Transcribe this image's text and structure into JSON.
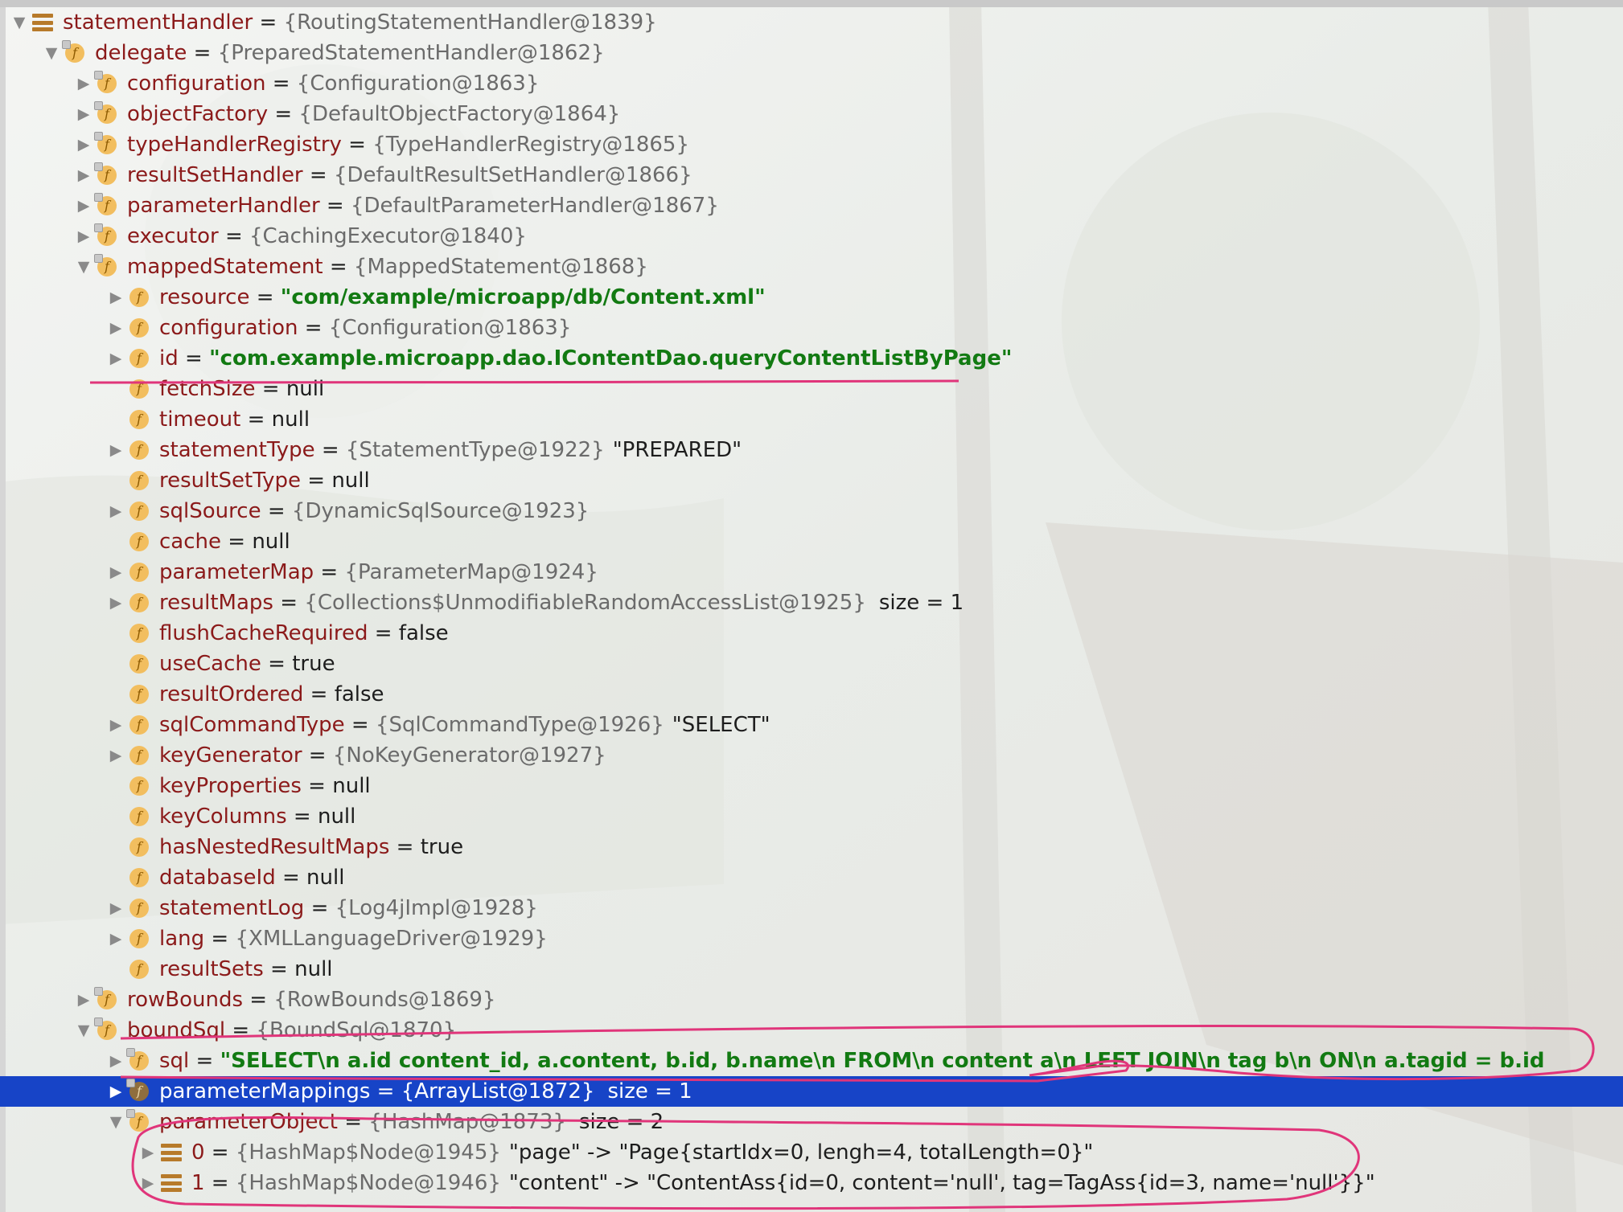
{
  "colors": {
    "field_name": "#8b1a1a",
    "object_ref": "#6b6b6b",
    "string_value": "#127a12",
    "selection": "#1744c7",
    "field_icon": "#f2be5f",
    "annotation": "#e0357a"
  },
  "tree": [
    {
      "depth": 0,
      "expand": "open",
      "icon": "variable-icon",
      "name": "statementHandler",
      "ref": "{RoutingStatementHandler@1839}"
    },
    {
      "depth": 1,
      "expand": "open",
      "icon": "field-icon",
      "name": "delegate",
      "ref": "{PreparedStatementHandler@1862}"
    },
    {
      "depth": 2,
      "expand": "closed",
      "icon": "field-icon",
      "name": "configuration",
      "ref": "{Configuration@1863}"
    },
    {
      "depth": 2,
      "expand": "closed",
      "icon": "field-icon",
      "name": "objectFactory",
      "ref": "{DefaultObjectFactory@1864}"
    },
    {
      "depth": 2,
      "expand": "closed",
      "icon": "field-icon",
      "name": "typeHandlerRegistry",
      "ref": "{TypeHandlerRegistry@1865}"
    },
    {
      "depth": 2,
      "expand": "closed",
      "icon": "field-icon",
      "name": "resultSetHandler",
      "ref": "{DefaultResultSetHandler@1866}"
    },
    {
      "depth": 2,
      "expand": "closed",
      "icon": "field-icon",
      "name": "parameterHandler",
      "ref": "{DefaultParameterHandler@1867}"
    },
    {
      "depth": 2,
      "expand": "closed",
      "icon": "field-icon",
      "name": "executor",
      "ref": "{CachingExecutor@1840}"
    },
    {
      "depth": 2,
      "expand": "open",
      "icon": "field-icon",
      "name": "mappedStatement",
      "ref": "{MappedStatement@1868}"
    },
    {
      "depth": 3,
      "expand": "closed",
      "icon": "field-icon",
      "name": "resource",
      "str": "\"com/example/microapp/db/Content.xml\""
    },
    {
      "depth": 3,
      "expand": "closed",
      "icon": "field-icon",
      "name": "configuration",
      "ref": "{Configuration@1863}"
    },
    {
      "depth": 3,
      "expand": "closed",
      "icon": "field-icon",
      "name": "id",
      "str": "\"com.example.microapp.dao.IContentDao.queryContentListByPage\""
    },
    {
      "depth": 3,
      "expand": "none",
      "icon": "field-icon",
      "name": "fetchSize",
      "val": "null"
    },
    {
      "depth": 3,
      "expand": "none",
      "icon": "field-icon",
      "name": "timeout",
      "val": "null"
    },
    {
      "depth": 3,
      "expand": "closed",
      "icon": "field-icon",
      "name": "statementType",
      "ref": "{StatementType@1922}",
      "val": "\"PREPARED\""
    },
    {
      "depth": 3,
      "expand": "none",
      "icon": "field-icon",
      "name": "resultSetType",
      "val": "null"
    },
    {
      "depth": 3,
      "expand": "closed",
      "icon": "field-icon",
      "name": "sqlSource",
      "ref": "{DynamicSqlSource@1923}"
    },
    {
      "depth": 3,
      "expand": "none",
      "icon": "field-icon",
      "name": "cache",
      "val": "null"
    },
    {
      "depth": 3,
      "expand": "closed",
      "icon": "field-icon",
      "name": "parameterMap",
      "ref": "{ParameterMap@1924}"
    },
    {
      "depth": 3,
      "expand": "closed",
      "icon": "field-icon",
      "name": "resultMaps",
      "ref": "{Collections$UnmodifiableRandomAccessList@1925}",
      "size": "size = 1"
    },
    {
      "depth": 3,
      "expand": "none",
      "icon": "field-icon",
      "name": "flushCacheRequired",
      "val": "false"
    },
    {
      "depth": 3,
      "expand": "none",
      "icon": "field-icon",
      "name": "useCache",
      "val": "true"
    },
    {
      "depth": 3,
      "expand": "none",
      "icon": "field-icon",
      "name": "resultOrdered",
      "val": "false"
    },
    {
      "depth": 3,
      "expand": "closed",
      "icon": "field-icon",
      "name": "sqlCommandType",
      "ref": "{SqlCommandType@1926}",
      "val": "\"SELECT\""
    },
    {
      "depth": 3,
      "expand": "closed",
      "icon": "field-icon",
      "name": "keyGenerator",
      "ref": "{NoKeyGenerator@1927}"
    },
    {
      "depth": 3,
      "expand": "none",
      "icon": "field-icon",
      "name": "keyProperties",
      "val": "null"
    },
    {
      "depth": 3,
      "expand": "none",
      "icon": "field-icon",
      "name": "keyColumns",
      "val": "null"
    },
    {
      "depth": 3,
      "expand": "none",
      "icon": "field-icon",
      "name": "hasNestedResultMaps",
      "val": "true"
    },
    {
      "depth": 3,
      "expand": "none",
      "icon": "field-icon",
      "name": "databaseId",
      "val": "null"
    },
    {
      "depth": 3,
      "expand": "closed",
      "icon": "field-icon",
      "name": "statementLog",
      "ref": "{Log4jImpl@1928}"
    },
    {
      "depth": 3,
      "expand": "closed",
      "icon": "field-icon",
      "name": "lang",
      "ref": "{XMLLanguageDriver@1929}"
    },
    {
      "depth": 3,
      "expand": "none",
      "icon": "field-icon",
      "name": "resultSets",
      "val": "null"
    },
    {
      "depth": 2,
      "expand": "closed",
      "icon": "field-icon",
      "name": "rowBounds",
      "ref": "{RowBounds@1869}"
    },
    {
      "depth": 2,
      "expand": "open",
      "icon": "field-icon",
      "name": "boundSql",
      "ref": "{BoundSql@1870}"
    },
    {
      "depth": 3,
      "expand": "closed",
      "icon": "field-icon",
      "name": "sql",
      "str": "\"SELECT\\n      a.id content_id, a.content, b.id, b.name\\n      FROM\\n      content a\\n      LEFT JOIN\\n      tag b\\n      ON\\n      a.tagid = b.id"
    },
    {
      "depth": 3,
      "expand": "closed",
      "icon": "field-icon",
      "name": "parameterMappings",
      "ref": "{ArrayList@1872}",
      "size": "size = 1",
      "selected": true
    },
    {
      "depth": 3,
      "expand": "open",
      "icon": "field-icon",
      "name": "parameterObject",
      "ref": "{HashMap@1873}",
      "size": "size = 2"
    },
    {
      "depth": 4,
      "expand": "closed",
      "icon": "entry-icon",
      "name": "0",
      "ref": "{HashMap$Node@1945}",
      "val": "\"page\" -> \"Page{startIdx=0, lengh=4, totalLength=0}\""
    },
    {
      "depth": 4,
      "expand": "closed",
      "icon": "entry-icon",
      "name": "1",
      "ref": "{HashMap$Node@1946}",
      "val": "\"content\" -> \"ContentAss{id=0, content='null', tag=TagAss{id=3, name='null'}}\""
    }
  ]
}
